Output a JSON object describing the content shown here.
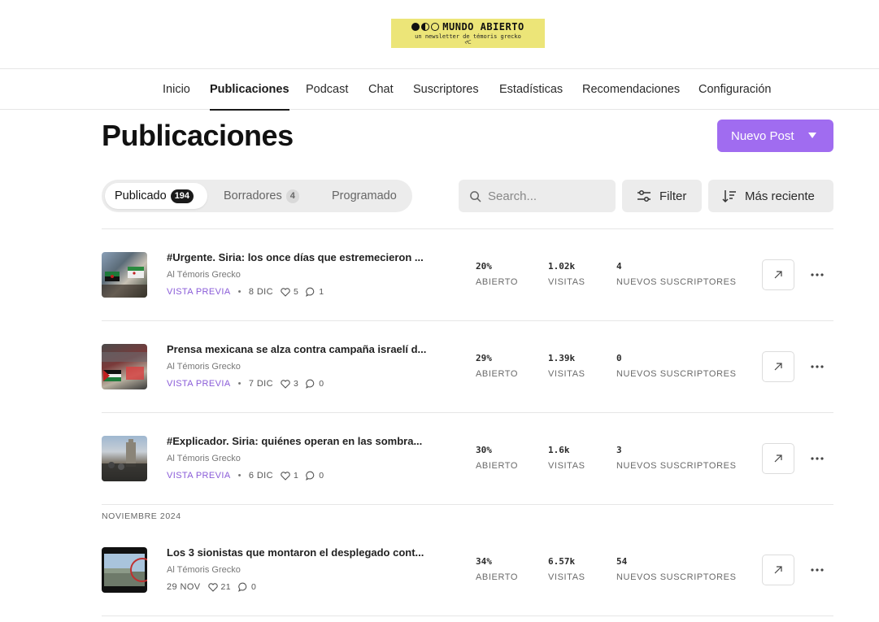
{
  "header": {
    "logo": {
      "title": "MUNDO ABIERTO",
      "subtitle": "un newsletter de témoris grecko",
      "mark": "ᔪᑕ",
      "bg_color": "#ece578"
    }
  },
  "nav": {
    "items": [
      {
        "label": "Inicio",
        "active": false
      },
      {
        "label": "Publicaciones",
        "active": true
      },
      {
        "label": "Podcast",
        "active": false
      },
      {
        "label": "Chat",
        "active": false
      },
      {
        "label": "Suscriptores",
        "active": false
      },
      {
        "label": "Estadísticas",
        "active": false
      },
      {
        "label": "Recomendaciones",
        "active": false
      },
      {
        "label": "Configuración",
        "active": false
      }
    ]
  },
  "page": {
    "title": "Publicaciones",
    "new_post_label": "Nuevo Post",
    "accent_color": "#a06cf0"
  },
  "tabs": [
    {
      "label": "Publicado",
      "count": "194",
      "active": true
    },
    {
      "label": "Borradores",
      "count": "4",
      "active": false
    },
    {
      "label": "Programado",
      "count": "",
      "active": false
    }
  ],
  "search": {
    "placeholder": "Search...",
    "value": ""
  },
  "filter_label": "Filter",
  "sort_label": "Más reciente",
  "section_label": "NOVIEMBRE 2024",
  "metric_labels": {
    "open": "ABIERTO",
    "views": "VISITAS",
    "subs": "NUEVOS SUSCRIPTORES"
  },
  "preview_label": "VISTA PREVIA",
  "posts": [
    {
      "title": "#Urgente. Siria: los once días que estremecieron ...",
      "author": "Al Témoris Grecko",
      "date": "8 DIC",
      "likes": "5",
      "comments": "1",
      "open_rate": "20%",
      "views": "1.02k",
      "new_subs": "4",
      "show_preview": true
    },
    {
      "title": "Prensa mexicana se alza contra campaña israelí d...",
      "author": "Al Témoris Grecko",
      "date": "7 DIC",
      "likes": "3",
      "comments": "0",
      "open_rate": "29%",
      "views": "1.39k",
      "new_subs": "0",
      "show_preview": true
    },
    {
      "title": "#Explicador. Siria: quiénes operan en las sombra...",
      "author": "Al Témoris Grecko",
      "date": "6 DIC",
      "likes": "1",
      "comments": "0",
      "open_rate": "30%",
      "views": "1.6k",
      "new_subs": "3",
      "show_preview": true
    },
    {
      "title": "Los 3 sionistas que montaron el desplegado cont...",
      "author": "Al Témoris Grecko",
      "date": "29 NOV",
      "likes": "21",
      "comments": "0",
      "open_rate": "34%",
      "views": "6.57k",
      "new_subs": "54",
      "show_preview": false
    }
  ]
}
